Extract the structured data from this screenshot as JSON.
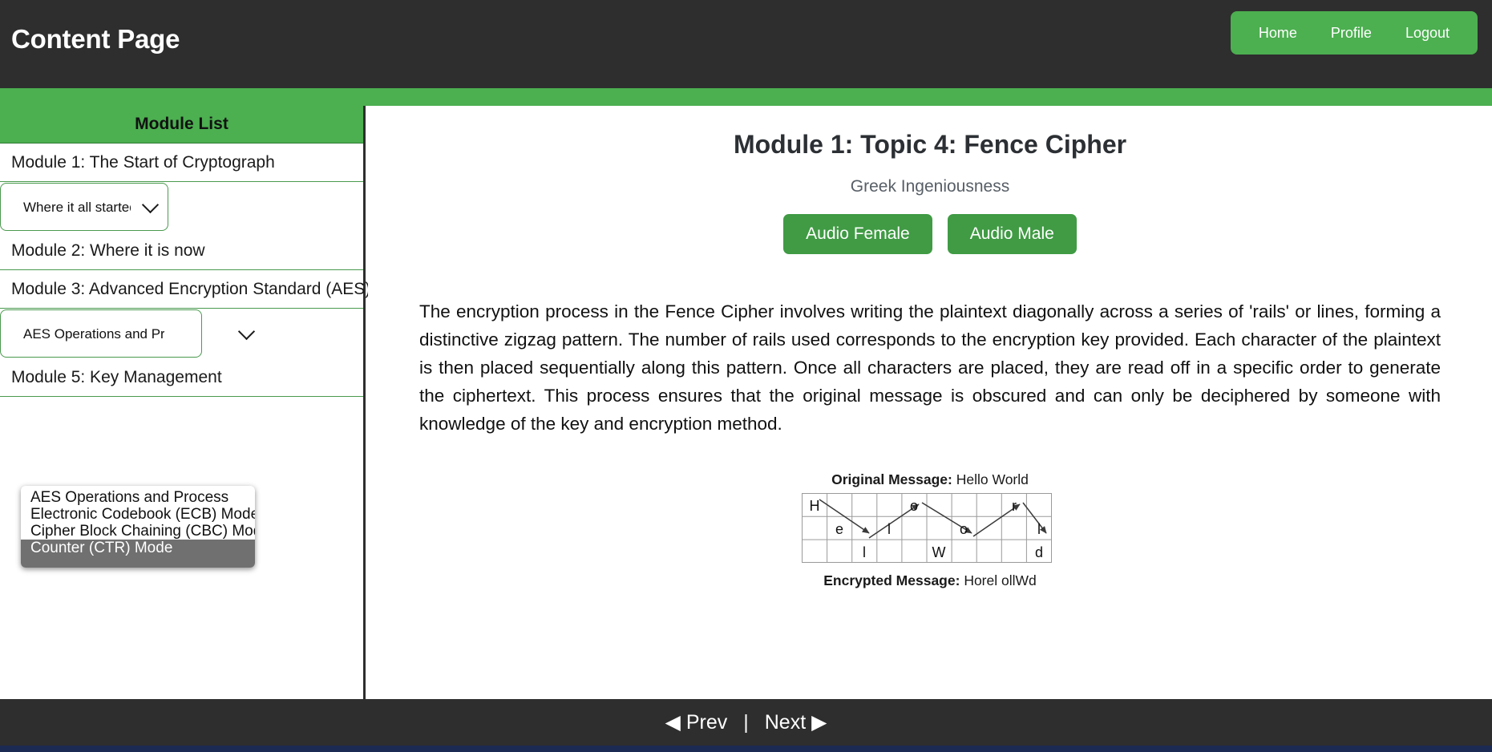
{
  "header": {
    "title": "Content Page",
    "nav": [
      {
        "label": "Home",
        "name": "nav-link-home"
      },
      {
        "label": "Profile",
        "name": "nav-link-profile"
      },
      {
        "label": "Logout",
        "name": "nav-link-logout"
      }
    ]
  },
  "sidebar": {
    "list_title": "Module List",
    "modules": [
      {
        "label": "Module 1: The Start of Cryptograph"
      },
      {
        "label": "Module 2: Where it is now"
      },
      {
        "label": "Module 3: Advanced Encryption Standard (AES)"
      },
      {
        "label": "Module 5: Key Management"
      }
    ],
    "module1_select": {
      "value": "Where it all started"
    },
    "module3_select": {
      "value": "AES Operations and Process",
      "expanded": true,
      "options": [
        {
          "label": "AES Operations and Process",
          "selected": false
        },
        {
          "label": "Electronic Codebook (ECB) Mode",
          "selected": false
        },
        {
          "label": "Cipher Block Chaining (CBC) Mode",
          "selected": false
        },
        {
          "label": "Counter (CTR) Mode",
          "selected": true
        }
      ]
    }
  },
  "main": {
    "title": "Module 1: Topic 4: Fence Cipher",
    "subtitle": "Greek Ingeniousness",
    "audio_female_label": "Audio Female",
    "audio_male_label": "Audio Male",
    "body": "The encryption process in the Fence Cipher involves writing the plaintext diagonally across a series of 'rails' or lines, forming a distinctive zigzag pattern. The number of rails used corresponds to the encryption key provided. Each character of the plaintext is then placed sequentially along this pattern. Once all characters are placed, they are read off in a specific order to generate the ciphertext. This process ensures that the original message is obscured and can only be deciphered by someone with knowledge of the key and encryption method.",
    "figure": {
      "original_label": "Original Message:",
      "original_value": "Hello World",
      "encrypted_label": "Encrypted Message:",
      "encrypted_value": "Horel ollWd",
      "rails": [
        [
          "H",
          "",
          "",
          "",
          "o",
          "",
          "",
          "",
          "r",
          ""
        ],
        [
          "",
          "e",
          "",
          "l",
          "",
          "",
          "o",
          "",
          "",
          "l"
        ],
        [
          "",
          "",
          "l",
          "",
          "",
          "W",
          "",
          "",
          "",
          "d"
        ]
      ]
    }
  },
  "footer": {
    "prev_label": "Prev",
    "next_label": "Next",
    "divider": "|",
    "prev_arrow": "◀",
    "next_arrow": "▶"
  },
  "colors": {
    "accent_green": "#4caf50",
    "header_dark": "#2e2e2e",
    "title_slate": "#2c3034"
  }
}
